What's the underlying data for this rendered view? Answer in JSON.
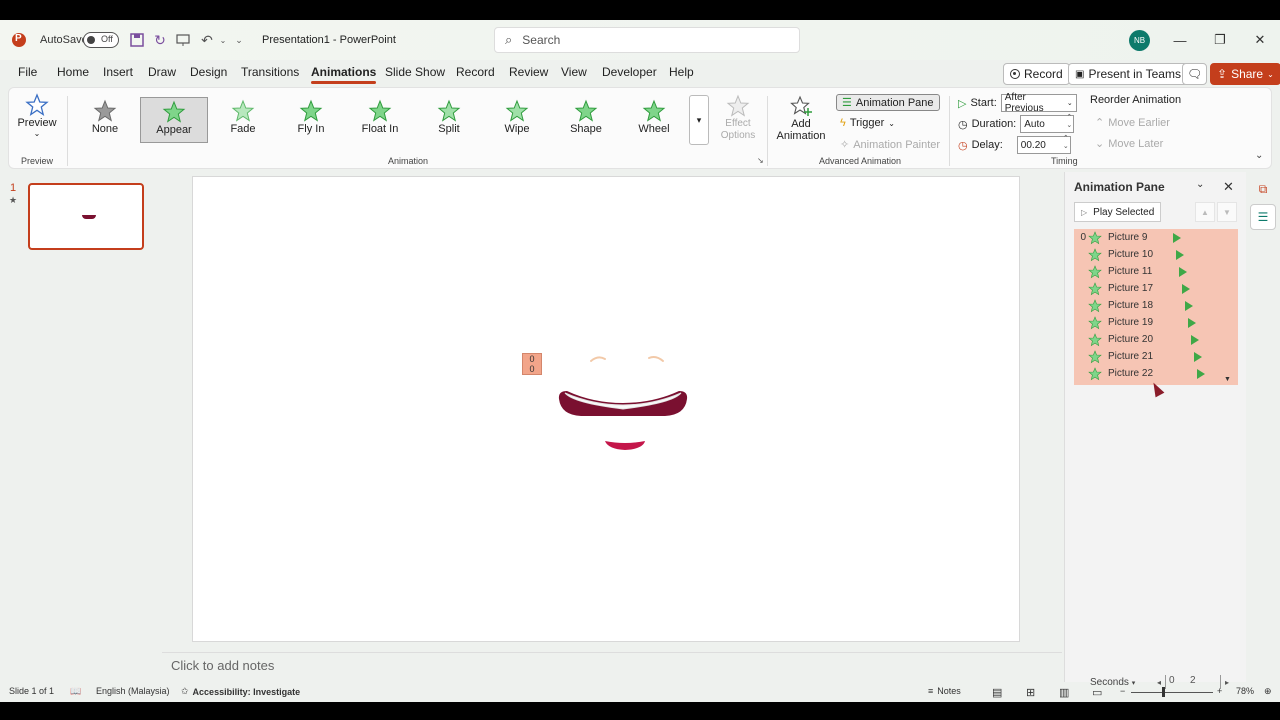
{
  "titlebar": {
    "autosave_label": "AutoSave",
    "autosave_state": "Off",
    "doc_title": "Presentation1  -  PowerPoint",
    "search_placeholder": "Search",
    "user_initials": "NB"
  },
  "menu": {
    "tabs": [
      "File",
      "Home",
      "Insert",
      "Draw",
      "Design",
      "Transitions",
      "Animations",
      "Slide Show",
      "Record",
      "Review",
      "View",
      "Developer",
      "Help"
    ],
    "active_tab": "Animations",
    "record_label": "Record",
    "present_label": "Present in Teams",
    "share_label": "Share"
  },
  "ribbon": {
    "preview": {
      "label": "Preview",
      "group": "Preview"
    },
    "animation_gallery": [
      "None",
      "Appear",
      "Fade",
      "Fly In",
      "Float In",
      "Split",
      "Wipe",
      "Shape",
      "Wheel"
    ],
    "selected_animation": "Appear",
    "effect_options_label": "Effect\nOptions",
    "animation_group_label": "Animation",
    "add_animation_label": "Add\nAnimation",
    "animation_pane_label": "Animation Pane",
    "trigger_label": "Trigger",
    "animation_painter_label": "Animation Painter",
    "advanced_group_label": "Advanced Animation",
    "start_label": "Start:",
    "start_value": "After Previous",
    "duration_label": "Duration:",
    "duration_value": "Auto",
    "delay_label": "Delay:",
    "delay_value": "00.20",
    "timing_group_label": "Timing",
    "reorder_label": "Reorder Animation",
    "move_earlier_label": "Move Earlier",
    "move_later_label": "Move Later"
  },
  "thumbnails": {
    "slide_number": "1",
    "star": "★"
  },
  "slide": {
    "anim_tag": [
      "0",
      "0"
    ],
    "notes_placeholder": "Click to add notes"
  },
  "animation_pane": {
    "title": "Animation Pane",
    "play_selected": "Play Selected",
    "first_index": "0",
    "items": [
      "Picture 9",
      "Picture 10",
      "Picture 11",
      "Picture 17",
      "Picture 18",
      "Picture 19",
      "Picture 20",
      "Picture 21",
      "Picture 22"
    ],
    "seconds_label": "Seconds",
    "timeline_start": "0",
    "timeline_mark": "2"
  },
  "statusbar": {
    "slide_info": "Slide 1 of 1",
    "language": "English (Malaysia)",
    "accessibility": "Accessibility: Investigate",
    "notes_label": "Notes",
    "zoom": "78%"
  },
  "colors": {
    "accent": "#c43e1c",
    "selection_fill": "#f6c5b4",
    "star_green": "#3fa847",
    "lip_dark": "#7a1030",
    "lip_light": "#c4164a"
  }
}
